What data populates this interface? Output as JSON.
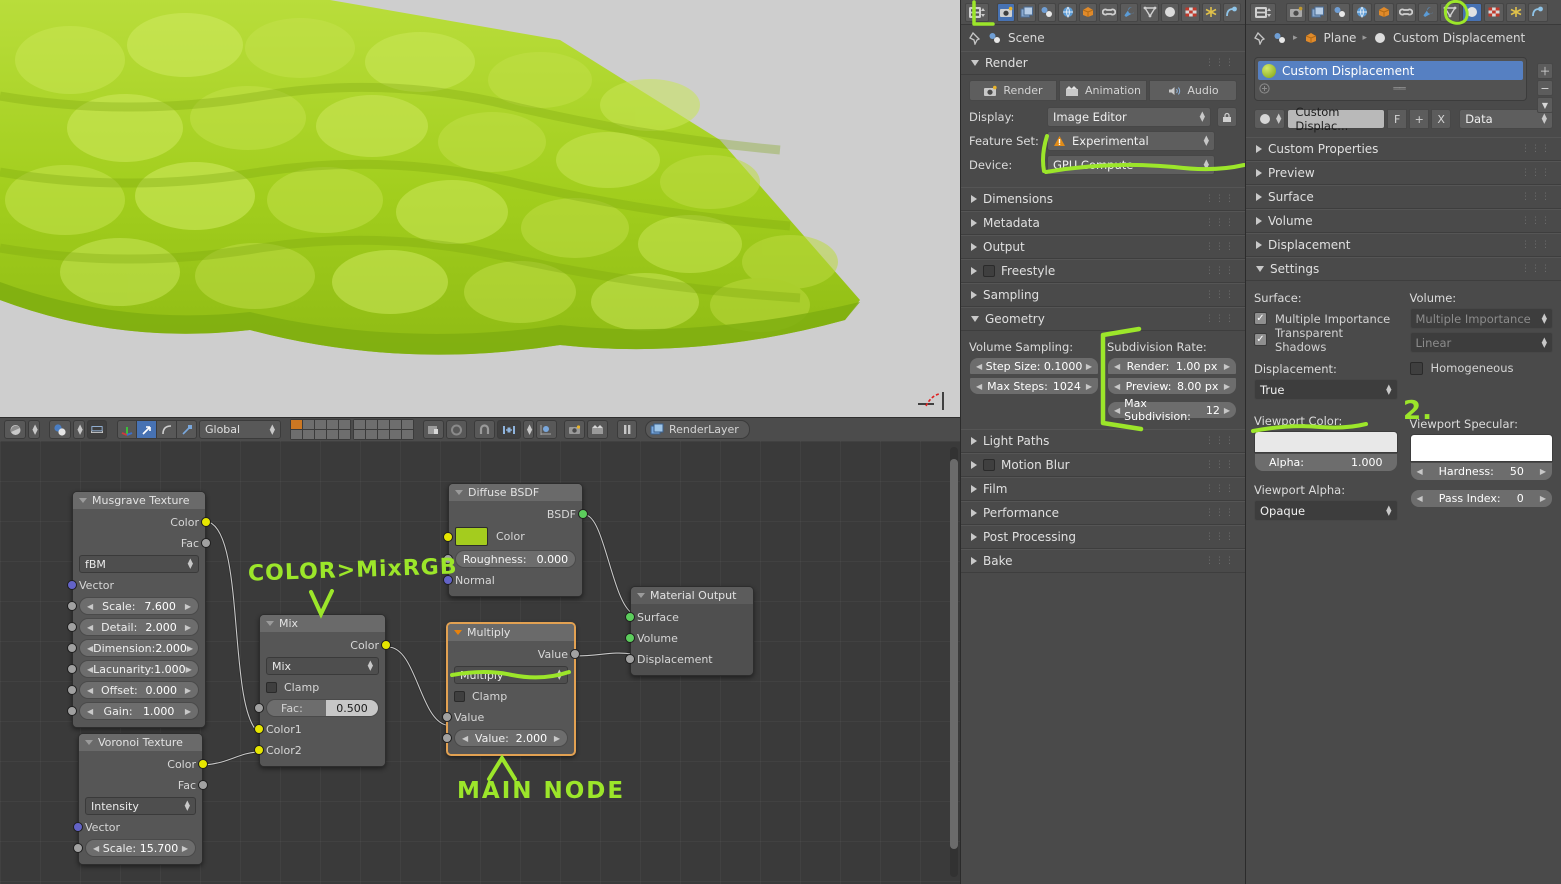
{
  "viewport": {
    "header": {
      "mode_select_label": "",
      "transform_orientation": "Global",
      "render_layer_label": "RenderLayer",
      "icons": [
        "object-mode-icon",
        "mode-spin-icon",
        "shading-icon",
        "shading-spin-icon",
        "pivot-icon",
        "manipulator-translate-icon",
        "manipulator-rotate-icon",
        "manipulator-scale-icon",
        "snap-magnet-icon",
        "snap-mode-icon",
        "proportional-edit-icon",
        "render-icon",
        "animation-render-icon",
        "pause-icon",
        "renderlayer-icon"
      ]
    }
  },
  "node_editor": {
    "nodes": [
      {
        "name": "musgrave-texture",
        "title": "Musgrave Texture",
        "outputs": [
          "Color",
          "Fac"
        ],
        "type_select": "fBM",
        "vector_label": "Vector",
        "fields": [
          {
            "label": "Scale:",
            "value": "7.600"
          },
          {
            "label": "Detail:",
            "value": "2.000"
          },
          {
            "label": "Dimension:",
            "value": "2.000"
          },
          {
            "label": "Lacunarity:",
            "value": "1.000"
          },
          {
            "label": "Offset:",
            "value": "0.000"
          },
          {
            "label": "Gain:",
            "value": "1.000"
          }
        ]
      },
      {
        "name": "voronoi-texture",
        "title": "Voronoi Texture",
        "outputs": [
          "Color",
          "Fac"
        ],
        "type_select": "Intensity",
        "vector_label": "Vector",
        "fields": [
          {
            "label": "Scale:",
            "value": "15.700"
          }
        ]
      },
      {
        "name": "mix-node",
        "title": "Mix",
        "outputs": [
          "Color"
        ],
        "blend_select": "Mix",
        "clamp_label": "Clamp",
        "fac_label": "Fac:",
        "fac_value": "0.500",
        "inputs": [
          "Color1",
          "Color2"
        ]
      },
      {
        "name": "diffuse-bsdf",
        "title": "Diffuse BSDF",
        "outputs": [
          "BSDF"
        ],
        "color_label": "Color",
        "color_swatch": "#a4cc1e",
        "roughness_label": "Roughness:",
        "roughness_value": "0.000",
        "normal_label": "Normal"
      },
      {
        "name": "multiply-math-node",
        "title": "Multiply",
        "outputs": [
          "Value"
        ],
        "op_select": "Multiply",
        "clamp_label": "Clamp",
        "input_label": "Value",
        "value_label": "Value:",
        "value": "2.000",
        "selected": true
      },
      {
        "name": "material-output",
        "title": "Material Output",
        "inputs": [
          "Surface",
          "Volume",
          "Displacement"
        ]
      }
    ],
    "annotations": [
      {
        "name": "annotation-color-mixrgb",
        "text": "COLOR>MixRGB"
      },
      {
        "name": "annotation-main-node",
        "text": "MAIN NODE"
      },
      {
        "name": "annotation-step-2",
        "text": "2."
      }
    ]
  },
  "render_properties": {
    "icon_tabs": [
      "render-icon",
      "render-layers-icon",
      "scene-icon",
      "world-icon",
      "object-icon",
      "constraints-icon",
      "modifier-wrench-icon",
      "data-icon",
      "material-icon",
      "texture-icon",
      "particles-icon",
      "physics-icon"
    ],
    "active_tab": "render-icon",
    "breadcrumb": "Scene",
    "panels": [
      {
        "label": "Render",
        "open": true
      },
      {
        "label": "Dimensions",
        "open": false
      },
      {
        "label": "Metadata",
        "open": false
      },
      {
        "label": "Output",
        "open": false
      },
      {
        "label": "Freestyle",
        "open": false,
        "checkbox": true
      },
      {
        "label": "Sampling",
        "open": false
      },
      {
        "label": "Geometry",
        "open": true
      },
      {
        "label": "Light Paths",
        "open": false
      },
      {
        "label": "Motion Blur",
        "open": false,
        "checkbox": true
      },
      {
        "label": "Film",
        "open": false
      },
      {
        "label": "Performance",
        "open": false
      },
      {
        "label": "Post Processing",
        "open": false
      },
      {
        "label": "Bake",
        "open": false
      }
    ],
    "render_panel": {
      "buttons": [
        "Render",
        "Animation",
        "Audio"
      ],
      "display_label": "Display:",
      "display_value": "Image Editor",
      "feature_set_label": "Feature Set:",
      "feature_set_value": "Experimental",
      "device_label": "Device:",
      "device_value": "GPU Compute"
    },
    "geometry_panel": {
      "volume_sampling_label": "Volume Sampling:",
      "step_size_label": "Step Size:",
      "step_size_value": "0.1000",
      "max_steps_label": "Max Steps:",
      "max_steps_value": "1024",
      "subdivision_rate_label": "Subdivision Rate:",
      "render_label": "Render:",
      "render_value": "1.00 px",
      "preview_label": "Preview:",
      "preview_value": "8.00 px",
      "max_subdivision_label": "Max Subdivision:",
      "max_subdivision_value": "12"
    }
  },
  "material_properties": {
    "icon_tabs": [
      "render-icon",
      "render-layers-icon",
      "scene-icon",
      "world-icon",
      "object-icon",
      "constraints-icon",
      "modifier-wrench-icon",
      "data-icon",
      "material-icon",
      "texture-icon",
      "particles-icon",
      "physics-icon"
    ],
    "active_tab": "material-icon",
    "breadcrumb": {
      "scene": "",
      "object": "Plane",
      "material": "Custom Displacement"
    },
    "slot_list": [
      {
        "label": "Custom Displacement",
        "selected": true
      }
    ],
    "datablock": {
      "name": "Custom Displac...",
      "fake_user_label": "F",
      "new_label": "+",
      "unlink_label": "X",
      "link_mode": "Data"
    },
    "panels": [
      {
        "label": "Custom Properties",
        "open": false
      },
      {
        "label": "Preview",
        "open": false
      },
      {
        "label": "Surface",
        "open": false
      },
      {
        "label": "Volume",
        "open": false
      },
      {
        "label": "Displacement",
        "open": false
      },
      {
        "label": "Settings",
        "open": true
      }
    ],
    "settings": {
      "surface_label": "Surface:",
      "multiple_importance_label": "Multiple Importance",
      "transparent_shadows_label": "Transparent Shadows",
      "volume_label": "Volume:",
      "volume_sampling_value": "Multiple Importance",
      "volume_interpolation_value": "Linear",
      "homogeneous_label": "Homogeneous",
      "displacement_label": "Displacement:",
      "displacement_value": "True",
      "viewport_color_label": "Viewport Color:",
      "alpha_label": "Alpha:",
      "alpha_value": "1.000",
      "viewport_alpha_label": "Viewport Alpha:",
      "viewport_alpha_value": "Opaque",
      "viewport_specular_label": "Viewport Specular:",
      "hardness_label": "Hardness:",
      "hardness_value": "50",
      "pass_index_label": "Pass Index:",
      "pass_index_value": "0"
    }
  },
  "colors": {
    "ink": "#9ce62a",
    "accent_blue": "#4772b3",
    "render_green": "#a2ce1d"
  }
}
